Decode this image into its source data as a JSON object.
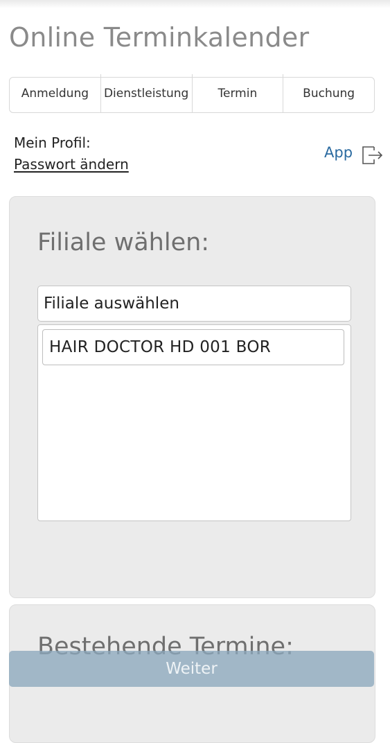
{
  "header": {
    "title": "Online Terminkalender"
  },
  "tabs": [
    {
      "label": "Anmeldung"
    },
    {
      "label": "Dienstleistung"
    },
    {
      "label": "Termin"
    },
    {
      "label": "Buchung"
    }
  ],
  "profile": {
    "label": "Mein Profil:",
    "change_password": "Passwort ändern",
    "app_link": "App",
    "exit_icon": "logout-icon"
  },
  "branch_section": {
    "heading": "Filiale wählen:",
    "select_placeholder": "Filiale auswählen",
    "options": [
      "HAIR DOCTOR HD 001 BOR"
    ]
  },
  "appointments_section": {
    "heading": "Bestehende Termine:"
  },
  "footer": {
    "next_button": "Weiter"
  },
  "colors": {
    "link_blue": "#2a6aa0",
    "button_bg": "#8ca8bc",
    "card_bg": "#ebebeb",
    "title_gray": "#8a8a8a"
  }
}
